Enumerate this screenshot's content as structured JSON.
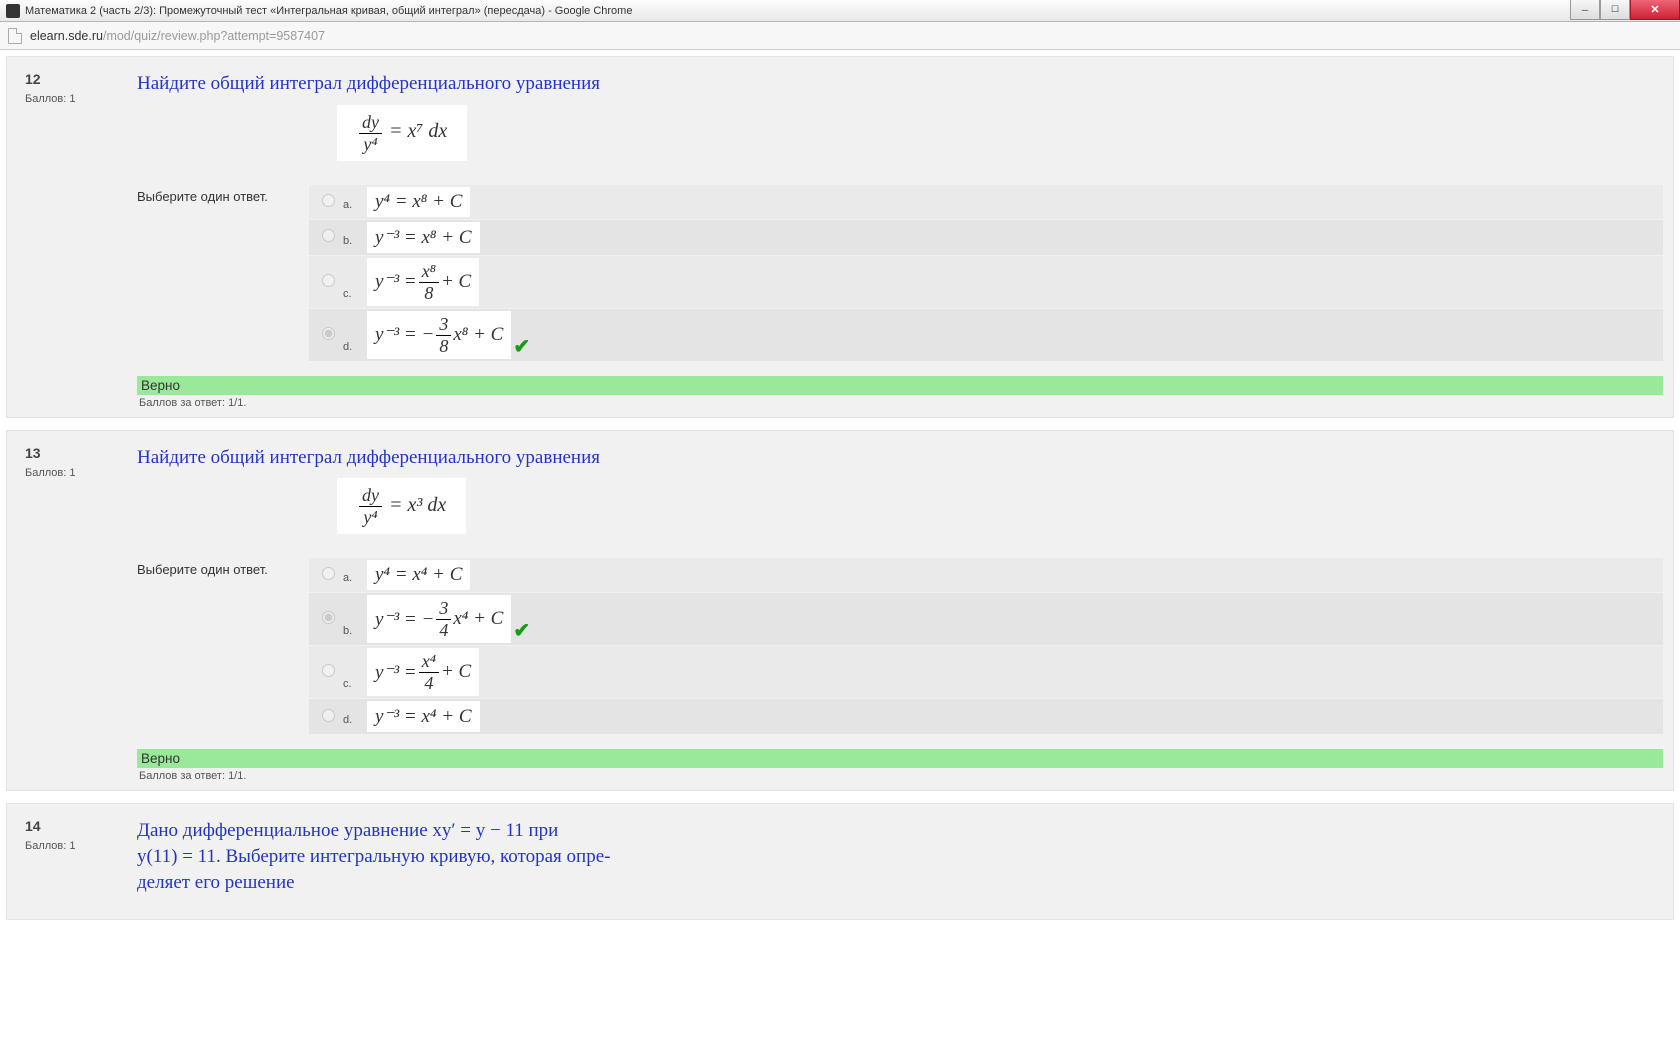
{
  "window": {
    "title": "Математика 2 (часть 2/3): Промежуточный тест «Интегральная кривая, общий интеграл» (пересдача) - Google Chrome"
  },
  "url": {
    "domain": "elearn.sde.ru",
    "path": "/mod/quiz/review.php?attempt=9587407"
  },
  "common": {
    "select_one": "Выберите один ответ.",
    "score_prefix": "Баллов:",
    "score_val": "1",
    "correct": "Верно",
    "answer_score": "Баллов за ответ: 1/1."
  },
  "q12": {
    "num": "12",
    "title": "Найдите общий интеграл дифференциального уравнения",
    "eq_lhs_num": "dy",
    "eq_lhs_den": "y⁴",
    "eq_rhs": " = x⁷ dx",
    "opts": {
      "a": "y⁴ = x⁸ + C",
      "b": "y⁻³ = x⁸ + C",
      "c_pre": "y⁻³ = ",
      "c_num": "x⁸",
      "c_den": "8",
      "c_post": " + C",
      "d_pre": "y⁻³ = − ",
      "d_num": "3",
      "d_den": "8",
      "d_post": " x⁸ + C"
    }
  },
  "q13": {
    "num": "13",
    "title": "Найдите общий интеграл дифференциального уравнения",
    "eq_lhs_num": "dy",
    "eq_lhs_den": "y⁴",
    "eq_rhs": " = x³ dx",
    "opts": {
      "a": "y⁴ = x⁴ + C",
      "b_pre": "y⁻³ = − ",
      "b_num": "3",
      "b_den": "4",
      "b_post": " x⁴ + C",
      "c_pre": "y⁻³ = ",
      "c_num": "x⁴",
      "c_den": "4",
      "c_post": " + C",
      "d": "y⁻³ = x⁴ + C"
    }
  },
  "q14": {
    "num": "14",
    "title_line1": "Дано дифференциальное уравнение xy′ = y − 11 при",
    "title_line2": "y(11) = 11. Выберите интегральную кривую, которая опре-",
    "title_line3": "деляет его решение"
  },
  "letters": {
    "a": "a.",
    "b": "b.",
    "c": "c.",
    "d": "d."
  }
}
